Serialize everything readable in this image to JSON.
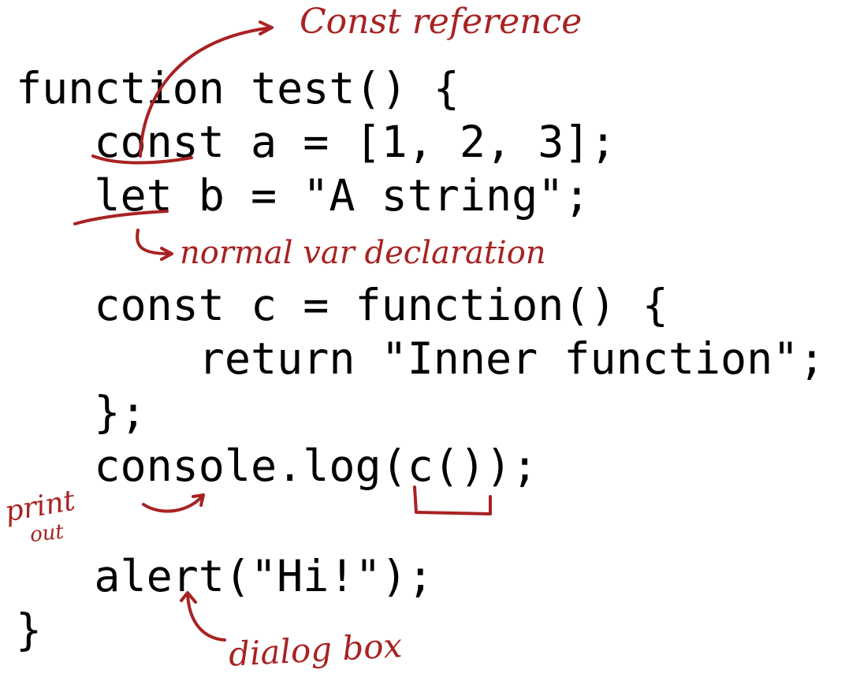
{
  "code": {
    "lines": [
      "function test() {",
      "   const a = [1, 2, 3];",
      "   let b = \"A string\";",
      "",
      "   const c = function() {",
      "       return \"Inner function\";",
      "   };",
      "   console.log(c());",
      "",
      "   alert(\"Hi!\");",
      "}"
    ]
  },
  "annotations": {
    "const_reference": "Const reference",
    "normal_var_declaration": "normal var declaration",
    "print_out_line1": "print",
    "print_out_line2": "out",
    "dialog_box": "dialog box"
  },
  "colors": {
    "ink": "#a82222",
    "code_text": "#000000",
    "background": "#ffffff"
  }
}
